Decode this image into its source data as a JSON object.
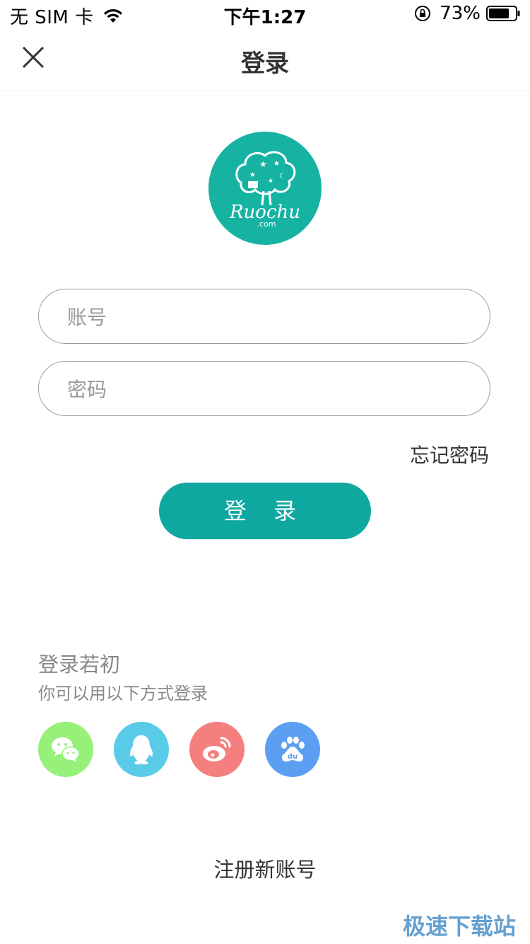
{
  "status_bar": {
    "carrier": "无 SIM 卡",
    "time": "下午1:27",
    "battery": "73%"
  },
  "nav": {
    "title": "登录",
    "close_icon": "close-icon"
  },
  "logo": {
    "text": "Ruochu",
    "subtext": ".com",
    "color": "#16b3a3"
  },
  "form": {
    "account_placeholder": "账号",
    "account_value": "",
    "password_placeholder": "密码",
    "password_value": "",
    "forgot_password": "忘记密码",
    "login_button": "登 录",
    "accent_color": "#0ea8a0"
  },
  "third_party": {
    "title": "登录若初",
    "subtitle": "你可以用以下方式登录",
    "providers": [
      {
        "name": "wechat",
        "icon": "wechat-icon",
        "color": "#97f07a"
      },
      {
        "name": "qq",
        "icon": "qq-icon",
        "color": "#59cbe8"
      },
      {
        "name": "weibo",
        "icon": "weibo-icon",
        "color": "#f57f7f"
      },
      {
        "name": "baidu",
        "icon": "baidu-icon",
        "color": "#5b9ef2"
      }
    ]
  },
  "register": "注册新账号",
  "watermark": "极速下载站"
}
